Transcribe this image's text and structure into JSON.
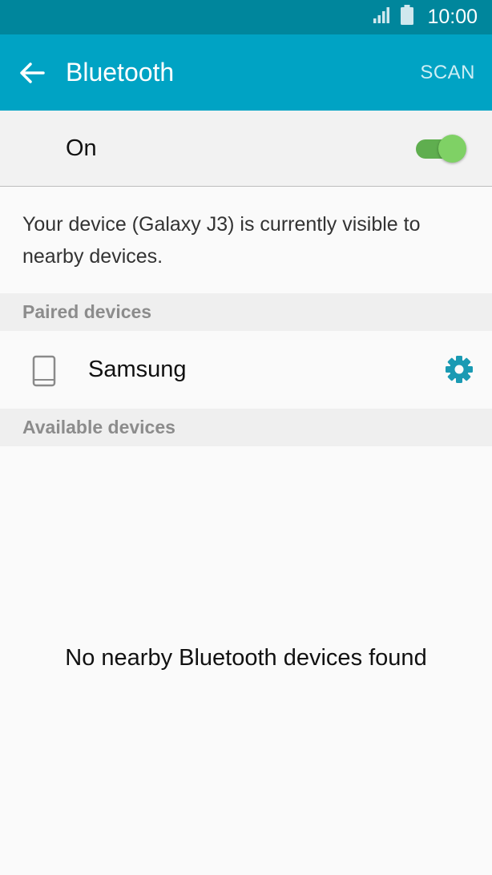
{
  "status_bar": {
    "signal_icon": "signal-icon",
    "battery_icon": "battery-icon",
    "time": "10:00"
  },
  "app_bar": {
    "back_icon": "arrow-left-icon",
    "title": "Bluetooth",
    "scan_label": "SCAN",
    "background": "#00a3c4"
  },
  "master_switch": {
    "label": "On",
    "state": true,
    "accent": "#5fae4f"
  },
  "visibility_text": "Your device (Galaxy J3) is currently visible to nearby devices.",
  "paired": {
    "header": "Paired devices",
    "devices": [
      {
        "name": "Samsung",
        "icon": "phone-icon",
        "settings_icon": "gear-icon"
      }
    ]
  },
  "available": {
    "header": "Available devices",
    "empty_message": "No nearby Bluetooth devices found"
  }
}
